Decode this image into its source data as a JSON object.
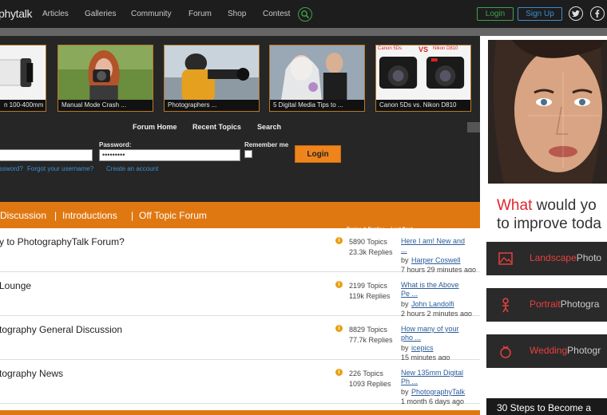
{
  "nav": {
    "logo": "phytalk",
    "links": [
      "Articles",
      "Galleries",
      "Community",
      "Forum",
      "Shop",
      "Contest"
    ],
    "login": "Login",
    "signup": "Sign Up"
  },
  "thumbnails": [
    {
      "caption": "n 100-400mm"
    },
    {
      "caption": "Manual Mode Crash ..."
    },
    {
      "caption": "Photographers ..."
    },
    {
      "caption": "5 Digital Media Tips to ..."
    },
    {
      "caption": "Canon 5Ds vs. Nikon D810"
    }
  ],
  "comparison_overlay": {
    "left": "Canon 5Ds",
    "vs": "VS",
    "right": "Nikon D810"
  },
  "forum_nav": {
    "home": "Forum Home",
    "recent": "Recent Topics",
    "search": "Search"
  },
  "login_form": {
    "password_label": "Password:",
    "password_value": "•••••••••",
    "remember_label": "Remember me",
    "button": "Login",
    "forgot_password": "ssword?",
    "forgot_username": "Forgot your username?",
    "create_account": "Create an account"
  },
  "category_bar": {
    "item1": "Discussion",
    "sep": "|",
    "item2": "Introductions",
    "item3": "Off Topic Forum"
  },
  "columns": {
    "topics_replies": "Topics & Replies",
    "last_post": "Last Post"
  },
  "forums": [
    {
      "title": "y to PhotographyTalk Forum?",
      "topics": "5890 Topics",
      "replies": "23.3k Replies",
      "lp_title1": "Here I am! New and",
      "lp_title2": "...",
      "by": "by",
      "author": "Harper Coswell",
      "ago": "7 hours 29 minutes ago"
    },
    {
      "title": "Lounge",
      "topics": "2199 Topics",
      "replies": "119k Replies",
      "lp_title1": "What is the Above",
      "lp_title2": "Pe ...",
      "by": "by",
      "author": "John Landolfi",
      "ago": "2 hours 2 minutes ago"
    },
    {
      "title": "tography General Discussion",
      "topics": "8829 Topics",
      "replies": "77.7k Replies",
      "lp_title1": "How many of your",
      "lp_title2": "pho ...",
      "by": "by",
      "author": "icepics",
      "ago": "15 minutes ago"
    },
    {
      "title": "tography News",
      "topics": "226 Topics",
      "replies": "1093 Replies",
      "lp_title1": "New 135mm Digital",
      "lp_title2": "Ph ...",
      "by": "by",
      "author": "PhotographyTalk",
      "ago": "1 month 6 days ago"
    }
  ],
  "ad": {
    "head_red": "What",
    "head_rest": "would yo",
    "head_line2": "to improve toda",
    "buttons": [
      {
        "red": "Landscape",
        "white": "Photo"
      },
      {
        "red": "Portrait",
        "white": "Photogra"
      },
      {
        "red": "Wedding",
        "white": "Photogr"
      }
    ],
    "footer": "30 Steps to Become a"
  },
  "colors": {
    "accent_orange": "#e07812",
    "green": "#3fa24a",
    "blue": "#3b8fd2",
    "ad_red": "#e0242c"
  }
}
